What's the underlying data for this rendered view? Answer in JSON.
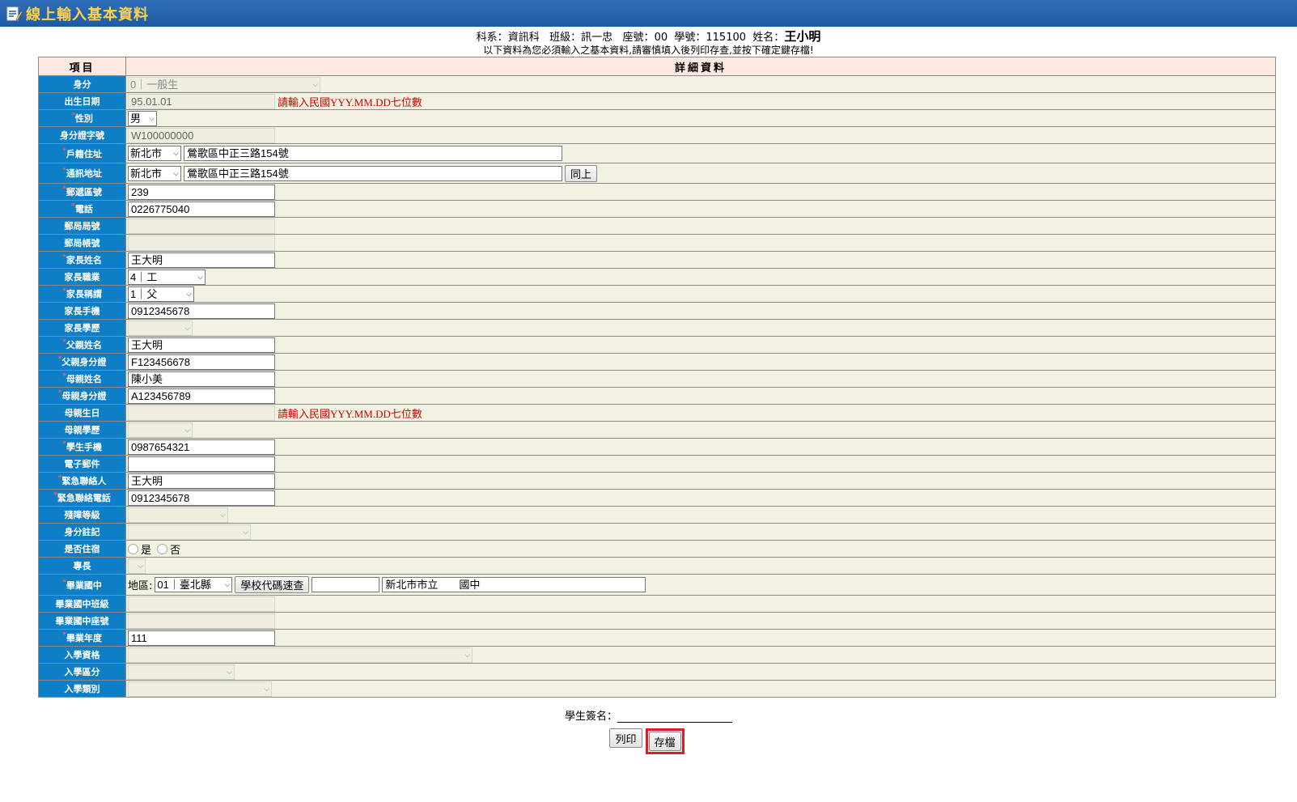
{
  "window": {
    "title": "線上輸入基本資料"
  },
  "student": {
    "dept_label": "科系：",
    "dept": "資訊科",
    "class_label": "班級：",
    "class": "訊一忠",
    "seat_label": "座號：",
    "seat": "00",
    "id_label": "學號：",
    "id": "115100",
    "name_label": "姓名：",
    "name": "王小明"
  },
  "notice": "以下資料為您必須輸入之基本資料,請審慎填入後列印存查,並按下確定鍵存檔!",
  "table": {
    "col_item": "項目",
    "col_detail": "詳細資料"
  },
  "rows": {
    "identity": {
      "label": "身分",
      "value": "0｜一般生"
    },
    "birth": {
      "label": "出生日期",
      "value": "95.01.01",
      "hint": "請輸入民國YYY.MM.DD七位數"
    },
    "gender": {
      "label": "性別",
      "value": "男"
    },
    "idno": {
      "label": "身分證字號",
      "value": "W100000000"
    },
    "reg_addr": {
      "label": "戶籍住址",
      "city": "新北市",
      "value": "鶯歌區中正三路154號"
    },
    "mail_addr": {
      "label": "通訊地址",
      "city": "新北市",
      "value": "鶯歌區中正三路154號",
      "same_btn": "同上"
    },
    "zip": {
      "label": "郵遞區號",
      "value": "239"
    },
    "phone": {
      "label": "電話",
      "value": "0226775040"
    },
    "post_office": {
      "label": "郵局局號",
      "value": ""
    },
    "post_account": {
      "label": "郵局帳號",
      "value": ""
    },
    "parent_name": {
      "label": "家長姓名",
      "value": "王大明"
    },
    "parent_job": {
      "label": "家長職業",
      "value": "4｜工"
    },
    "parent_title": {
      "label": "家長稱謂",
      "value": "1｜父"
    },
    "parent_mobile": {
      "label": "家長手機",
      "value": "0912345678"
    },
    "parent_edu": {
      "label": "家長學歷",
      "value": ""
    },
    "father_name": {
      "label": "父親姓名",
      "value": "王大明"
    },
    "father_id": {
      "label": "父親身分證",
      "value": "F123456678"
    },
    "mother_name": {
      "label": "母親姓名",
      "value": "陳小美"
    },
    "mother_id": {
      "label": "母親身分證",
      "value": "A123456789"
    },
    "mother_birth": {
      "label": "母親生日",
      "value": "",
      "hint": "請輸入民國YYY.MM.DD七位數"
    },
    "mother_edu": {
      "label": "母親學歷",
      "value": ""
    },
    "student_mobile": {
      "label": "學生手機",
      "value": "0987654321"
    },
    "email": {
      "label": "電子郵件",
      "value": ""
    },
    "emergency_name": {
      "label": "緊急聯絡人",
      "value": "王大明"
    },
    "emergency_phone": {
      "label": "緊急聯絡電話",
      "value": "0912345678"
    },
    "disability": {
      "label": "殘障等級",
      "value": ""
    },
    "id_note": {
      "label": "身分註記",
      "value": ""
    },
    "dorm": {
      "label": "是否住宿",
      "yes": "是",
      "no": "否"
    },
    "specialty": {
      "label": "專長",
      "value": ""
    },
    "junior_school": {
      "label": "畢業國中",
      "region_label": "地區:",
      "region": "01｜臺北縣",
      "lookup_btn": "學校代碼速查",
      "code": "",
      "school_name": "新北市市立　　國中"
    },
    "junior_class": {
      "label": "畢業國中班級",
      "value": ""
    },
    "junior_seat": {
      "label": "畢業國中座號",
      "value": ""
    },
    "grad_year": {
      "label": "畢業年度",
      "value": "111"
    },
    "admission": {
      "label": "入學資格",
      "value": ""
    },
    "admission_area": {
      "label": "入學區分",
      "value": ""
    },
    "admission_type": {
      "label": "入學類別",
      "value": ""
    }
  },
  "footer": {
    "signature_label": "學生簽名：",
    "print_btn": "列印",
    "save_btn": "存檔"
  },
  "colors": {
    "title_bar": "#1d5aa3",
    "title_text": "#ffd24a",
    "label_bg": "#0e7fc6",
    "value_bg": "#f3f2e2",
    "header_bg": "#fde9df",
    "hint": "#cc0000",
    "highlight": "#d81f27"
  }
}
